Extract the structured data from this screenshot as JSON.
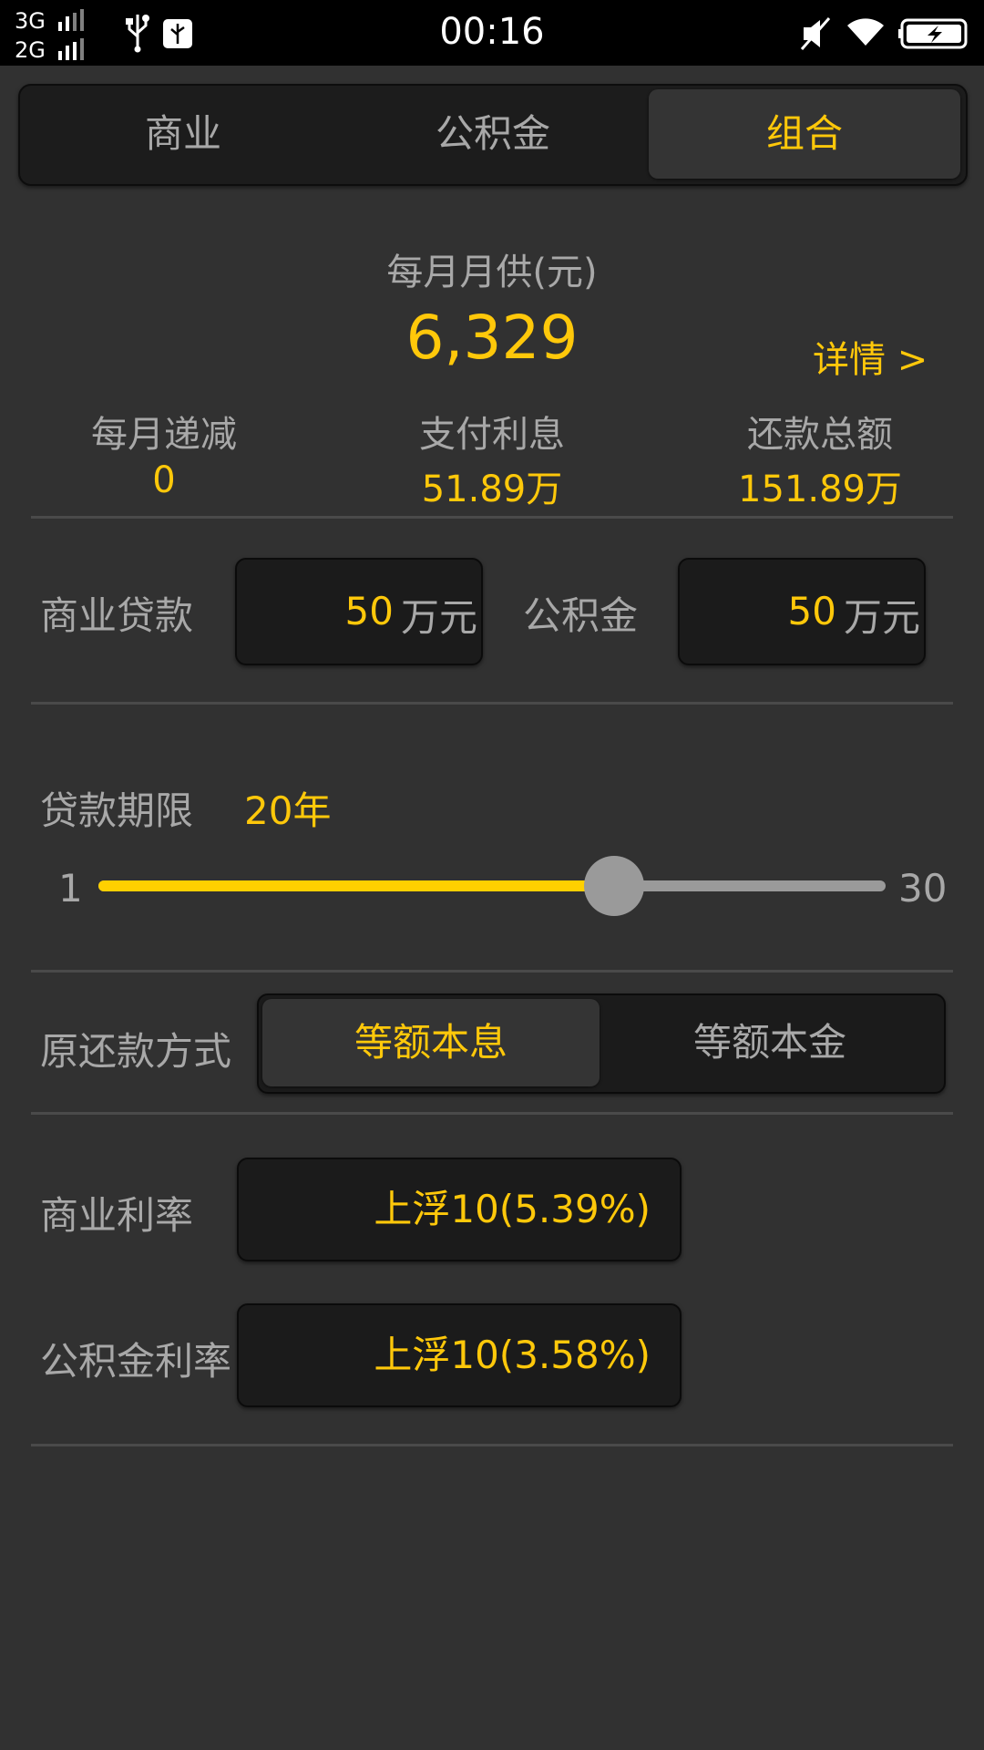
{
  "status_bar": {
    "network_1": "3G",
    "network_2": "2G",
    "time": "00:16",
    "icons": [
      "usb-icon",
      "usb-debug-icon",
      "mute-icon",
      "wifi-icon",
      "battery-charging-icon"
    ]
  },
  "tabs": [
    {
      "label": "商业",
      "active": false
    },
    {
      "label": "公积金",
      "active": false
    },
    {
      "label": "组合",
      "active": true
    }
  ],
  "summary": {
    "monthly_label": "每月月供(元)",
    "monthly_value": "6,329",
    "details_link": "详情 >",
    "stats": [
      {
        "label": "每月递减",
        "value": "0"
      },
      {
        "label": "支付利息",
        "value": "51.89万"
      },
      {
        "label": "还款总额",
        "value": "151.89万"
      }
    ]
  },
  "loans": {
    "commercial_label": "商业贷款",
    "commercial_value": "50",
    "fund_label": "公积金",
    "fund_value": "50",
    "unit": "万元"
  },
  "term": {
    "label": "贷款期限",
    "value": "20年",
    "min": "1",
    "max": "30",
    "slider_value": 20
  },
  "repayment": {
    "label": "原还款方式",
    "options": [
      {
        "label": "等额本息",
        "active": true
      },
      {
        "label": "等额本金",
        "active": false
      }
    ]
  },
  "rates": {
    "commercial_label": "商业利率",
    "commercial_value": "上浮10(5.39%)",
    "fund_label": "公积金利率",
    "fund_value": "上浮10(3.58%)"
  },
  "colors": {
    "accent": "#ffc80a",
    "background": "#313131",
    "text_muted": "#a8a8a8"
  }
}
